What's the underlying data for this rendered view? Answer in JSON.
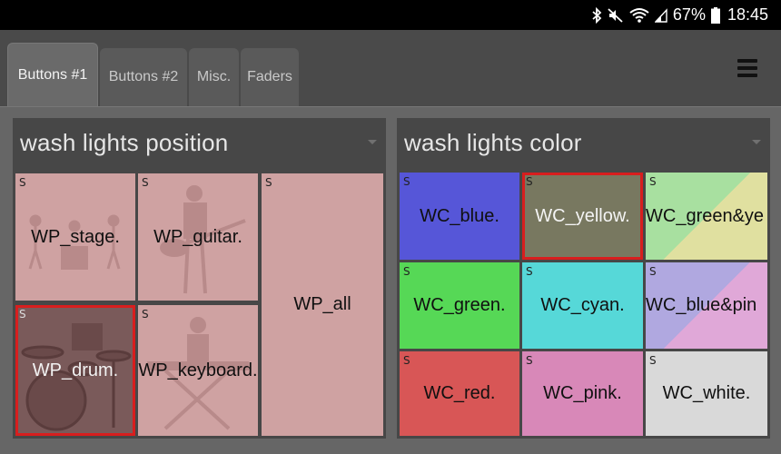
{
  "status_bar": {
    "battery": "67%",
    "time": "18:45",
    "icons": [
      "bluetooth-icon",
      "mute-icon",
      "wifi-icon",
      "signal-icon",
      "battery-icon"
    ]
  },
  "tabs": [
    {
      "label": "Buttons #1",
      "active": true
    },
    {
      "label": "Buttons #2",
      "active": false
    },
    {
      "label": "Misc.",
      "active": false
    },
    {
      "label": "Faders",
      "active": false
    }
  ],
  "panels": {
    "position": {
      "title": "wash lights position",
      "buttons": [
        {
          "label": "WP_stage.",
          "selected": false
        },
        {
          "label": "WP_guitar.",
          "selected": false
        },
        {
          "label": "WP_all",
          "selected": false
        },
        {
          "label": "WP_drum.",
          "selected": true
        },
        {
          "label": "WP_keyboard.",
          "selected": false
        }
      ]
    },
    "color": {
      "title": "wash lights color",
      "buttons": [
        {
          "label": "WC_blue.",
          "color": "#5656d8",
          "selected": false
        },
        {
          "label": "WC_yellow.",
          "color": "#787860",
          "selected": true
        },
        {
          "label": "WC_green&ye",
          "color": "#a8e0a0",
          "selected": false
        },
        {
          "label": "WC_green.",
          "color": "#56d856",
          "selected": false
        },
        {
          "label": "WC_cyan.",
          "color": "#56d8d8",
          "selected": false
        },
        {
          "label": "WC_blue&pin",
          "color": "#b0a8e0",
          "selected": false
        },
        {
          "label": "WC_red.",
          "color": "#d85656",
          "selected": false
        },
        {
          "label": "WC_pink.",
          "color": "#d888b8",
          "selected": false
        },
        {
          "label": "WC_white.",
          "color": "#d9d9d9",
          "selected": false
        }
      ]
    }
  },
  "button_marker": "S",
  "colors": {
    "selection_outline": "#d81e1e",
    "position_button": "#cfa2a2",
    "panel_header": "#474747"
  }
}
